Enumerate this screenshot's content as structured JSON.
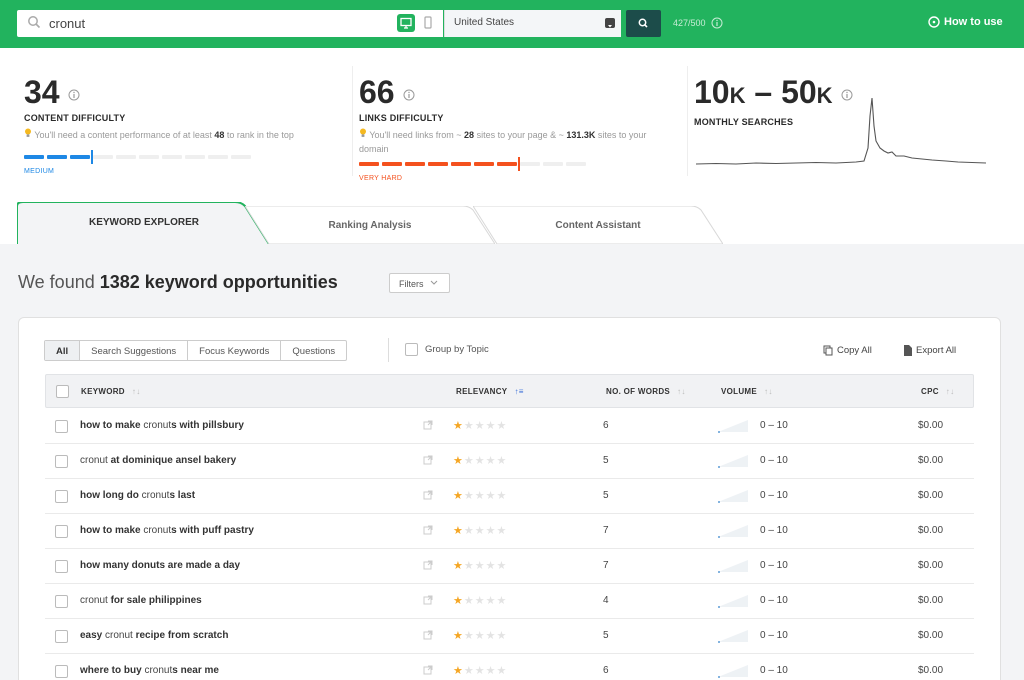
{
  "search": {
    "query": "cronut",
    "country": "United States",
    "quota": "427/500",
    "how_to_use": "How to use"
  },
  "metrics": {
    "content": {
      "value": "34",
      "label": "CONTENT DIFFICULTY",
      "note_pre": "You'll need a content performance of at least ",
      "note_num": "48",
      "note_post": " to rank in the top",
      "level": "MEDIUM",
      "level_color": "#1e88e5",
      "score": 34
    },
    "links": {
      "value": "66",
      "label": "LINKS DIFFICULTY",
      "note_pre": "You'll need links from ~ ",
      "note_num": "28",
      "note_mid": " sites to your page & ~ ",
      "note_num2": "131.3K",
      "note_post": " sites to your domain",
      "level": "VERY HARD",
      "level_color": "#f4511e",
      "score": 66
    },
    "searches": {
      "from": "10",
      "from_unit": "K",
      "dash": " – ",
      "to": "50",
      "to_unit": "K",
      "label": "MONTHLY SEARCHES"
    }
  },
  "tabs": [
    {
      "label": "KEYWORD EXPLORER"
    },
    {
      "label": "Ranking Analysis"
    },
    {
      "label": "Content Assistant"
    }
  ],
  "results": {
    "pre": "We found ",
    "count": "1382 keyword opportunities",
    "filters": "Filters"
  },
  "segments": [
    "All",
    "Search Suggestions",
    "Focus Keywords",
    "Questions"
  ],
  "group_by_topic": "Group by Topic",
  "copy_all": "Copy All",
  "export_all": "Export All",
  "columns": {
    "keyword": "KEYWORD",
    "relevancy": "RELEVANCY",
    "words": "NO. OF WORDS",
    "volume": "VOLUME",
    "cpc": "CPC"
  },
  "rows": [
    {
      "parts": [
        [
          "how to make",
          1
        ],
        [
          " cronut",
          0
        ],
        [
          "s with pillsbury",
          1
        ]
      ],
      "stars": 1,
      "words": "6",
      "volume": "0 – 10",
      "cpc": "$0.00"
    },
    {
      "parts": [
        [
          "cronut",
          0
        ],
        [
          " at dominique ansel bakery",
          1
        ]
      ],
      "stars": 1,
      "words": "5",
      "volume": "0 – 10",
      "cpc": "$0.00"
    },
    {
      "parts": [
        [
          "how long do",
          1
        ],
        [
          " cronut",
          0
        ],
        [
          "s last",
          1
        ]
      ],
      "stars": 1,
      "words": "5",
      "volume": "0 – 10",
      "cpc": "$0.00"
    },
    {
      "parts": [
        [
          "how to make",
          1
        ],
        [
          " cronut",
          0
        ],
        [
          "s with puff pastry",
          1
        ]
      ],
      "stars": 1,
      "words": "7",
      "volume": "0 – 10",
      "cpc": "$0.00"
    },
    {
      "parts": [
        [
          "how many donuts are made a day",
          1
        ]
      ],
      "stars": 1,
      "words": "7",
      "volume": "0 – 10",
      "cpc": "$0.00"
    },
    {
      "parts": [
        [
          "cronut",
          0
        ],
        [
          " for sale philippines",
          1
        ]
      ],
      "stars": 1,
      "words": "4",
      "volume": "0 – 10",
      "cpc": "$0.00"
    },
    {
      "parts": [
        [
          "easy",
          1
        ],
        [
          " cronut",
          0
        ],
        [
          " recipe from scratch",
          1
        ]
      ],
      "stars": 1,
      "words": "5",
      "volume": "0 – 10",
      "cpc": "$0.00"
    },
    {
      "parts": [
        [
          "where to buy",
          1
        ],
        [
          " cronut",
          0
        ],
        [
          "s near me",
          1
        ]
      ],
      "stars": 1,
      "words": "6",
      "volume": "0 – 10",
      "cpc": "$0.00"
    }
  ],
  "colors": {
    "brand_green": "#22b35e",
    "dark_button": "#1c4c4a",
    "star": "#f5a623",
    "medium": "#1e88e5",
    "very_hard": "#f4511e"
  }
}
